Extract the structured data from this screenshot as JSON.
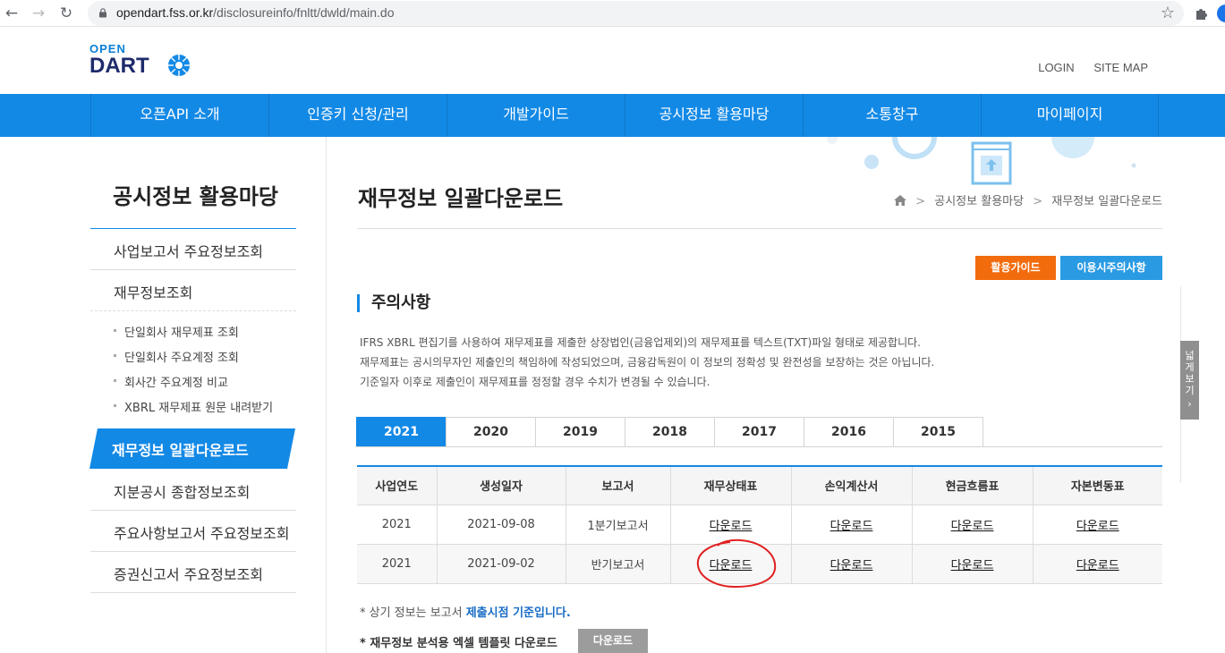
{
  "browser": {
    "url_host": "opendart.fss.or.kr",
    "url_path": "/disclosureinfo/fnltt/dwld/main.do"
  },
  "header": {
    "logo_open": "OPEN",
    "logo_dart": "DART",
    "login": "LOGIN",
    "sitemap": "SITE MAP"
  },
  "gnb": [
    "오픈API 소개",
    "인증키 신청/관리",
    "개발가이드",
    "공시정보 활용마당",
    "소통창구",
    "마이페이지"
  ],
  "sidebar": {
    "title": "공시정보 활용마당",
    "items": [
      "사업보고서 주요정보조회",
      "재무정보조회"
    ],
    "sub_items": [
      "단일회사 재무제표 조회",
      "단일회사 주요계정 조회",
      "회사간 주요계정 비교",
      "XBRL 재무제표 원문 내려받기"
    ],
    "active": "재무정보 일괄다운로드",
    "items_after": [
      "지분공시 종합정보조회",
      "주요사항보고서 주요정보조회",
      "증권신고서 주요정보조회"
    ]
  },
  "main": {
    "title": "재무정보 일괄다운로드",
    "breadcrumb": [
      "공시정보 활용마당",
      "재무정보 일괄다운로드"
    ],
    "btn_guide": "활용가이드",
    "btn_caution": "이용시주의사항",
    "section_title": "주의사항",
    "notices": [
      "IFRS XBRL 편집기를 사용하여 재무제표를 제출한 상장법인(금융업제외)의 재무제표를 텍스트(TXT)파일 형태로 제공합니다.",
      "재무제표는 공시의무자인 제출인의 책임하에 작성되었으며, 금융감독원이 이 정보의 정확성 및 완전성을 보장하는 것은 아닙니다.",
      "기준일자 이후로 제출인이 재무제표를 정정할 경우 수치가 변경될 수 있습니다."
    ],
    "tabs": [
      "2021",
      "2020",
      "2019",
      "2018",
      "2017",
      "2016",
      "2015"
    ],
    "active_tab": "2021",
    "table": {
      "headers": [
        "사업연도",
        "생성일자",
        "보고서",
        "재무상태표",
        "손익계산서",
        "현금흐름표",
        "자본변동표"
      ],
      "rows": [
        [
          "2021",
          "2021-09-08",
          "1분기보고서",
          "다운로드",
          "다운로드",
          "다운로드",
          "다운로드"
        ],
        [
          "2021",
          "2021-09-02",
          "반기보고서",
          "다운로드",
          "다운로드",
          "다운로드",
          "다운로드"
        ]
      ]
    },
    "foot_note_prefix": "* 상기 정보는 보고서 ",
    "foot_note_highlight": "제출시점 기준입니다.",
    "template_label": "* 재무정보 분석용 엑셀 템플릿 다운로드",
    "template_btn": "다운로드",
    "wide_view": "넓게보기"
  },
  "colors": {
    "primary": "#1389e6",
    "orange": "#f26c0d",
    "annotation_red": "#e02020"
  }
}
